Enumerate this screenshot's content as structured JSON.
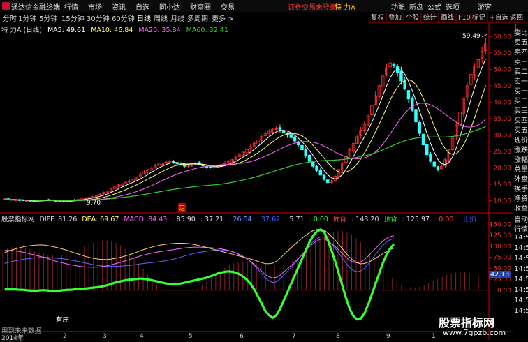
{
  "titlebar": {
    "app_name": "通达信金融终端",
    "menus": [
      "行情",
      "市场",
      "资讯",
      "自选",
      "同小达",
      "财富圈",
      "交易"
    ],
    "alert": "证券交易未登录",
    "stock_name": "特 力A",
    "right_menus": [
      "功能",
      "新盘",
      "公式",
      "选项"
    ],
    "guest": "游客",
    "win_buttons": [
      "—",
      "□",
      "✕"
    ]
  },
  "tabs": {
    "items": [
      "分时",
      "1分钟",
      "5分钟",
      "15分钟",
      "30分钟",
      "60分钟",
      "日线",
      "周线",
      "月线",
      "多周期",
      "更多 >"
    ],
    "active": "日线",
    "right_buttons": [
      "复权",
      "叠加",
      "个股",
      "统计",
      "画线",
      "F10",
      "标记",
      "+自选",
      "返回"
    ]
  },
  "main_header": {
    "name": "特 力A (日线)",
    "ma5": "MA5: 49.61",
    "ma10": "MA10: 46.84",
    "ma20": "MA20: 35.84",
    "ma60": "MA60: 32.41"
  },
  "indicator_header": {
    "name": "股票指标网",
    "diff": "DIFF: 81.26",
    "dea": "DEA: 69.67",
    "macd": "MACD: 84.43",
    "v1": ": 85.90",
    "v2": ": 37.21",
    "v3": ": 26.54",
    "v4": ": 37.62",
    "v5": ": 5.71",
    "v6": ": 0.00",
    "v7": "底背",
    "v8": ": 143.20",
    "v9": "顶背",
    "v10": ": 125.97",
    "v11": ": 0.00",
    "v12": ": 止损"
  },
  "annotations": {
    "low_price": "9.70",
    "high_price": "59.49",
    "ding_label": "定",
    "youzhuang": "有庄",
    "future_data": "用到未来数据",
    "macd_value": "42.13"
  },
  "right_panel": {
    "top_letters": "L",
    "items": [
      "委比",
      "卖五",
      "卖四",
      "卖三",
      "卖二",
      "卖一",
      "买一",
      "买二",
      "买三",
      "买四",
      "买五",
      "现价",
      "涨跌",
      "涨幅",
      "总量",
      "外盘",
      "换手",
      "净资",
      "收益"
    ],
    "bottom_items": [
      "自动",
      "行情",
      "14:5",
      "14:5",
      "14:5",
      "14:5",
      "14:5",
      "14:5",
      "14:5",
      "14:5"
    ]
  },
  "x_axis": {
    "year": "2014年",
    "months": [
      "2",
      "3",
      "4",
      "5",
      "6",
      "7",
      "8",
      "9",
      "1"
    ]
  },
  "watermark": {
    "title": "股票指标网",
    "url": "www.7gpzb.com"
  },
  "colors": {
    "up": "#ff3333",
    "down": "#33ffff",
    "ma5": "#ffffff",
    "ma10": "#ffff66",
    "ma20": "#ff66ff",
    "ma60": "#33cc33",
    "axis": "#cc0000",
    "green_line": "#33ff33"
  },
  "chart_data": [
    {
      "type": "candlestick",
      "title": "特 力A (日线)",
      "y_axis_ticks": [
        10.0,
        15.0,
        20.0,
        25.0,
        30.0,
        35.0,
        40.0,
        45.0,
        50.0,
        55.0,
        60.0
      ],
      "ylim": [
        8,
        62
      ],
      "annotations": {
        "low": 9.7,
        "high": 59.49
      },
      "series": [
        {
          "name": "MA5",
          "value": 49.61
        },
        {
          "name": "MA10",
          "value": 46.84
        },
        {
          "name": "MA20",
          "value": 35.84
        },
        {
          "name": "MA60",
          "value": 32.41
        }
      ],
      "close_path": [
        10.5,
        10.4,
        10.3,
        10.2,
        10.1,
        10.0,
        9.9,
        9.8,
        9.9,
        10.0,
        10.1,
        10.2,
        10.3,
        10.1,
        9.9,
        9.8,
        9.7,
        9.9,
        10.1,
        10.2,
        10.4,
        10.6,
        10.8,
        11.0,
        11.3,
        11.6,
        12.0,
        12.5,
        13.0,
        13.6,
        14.2,
        14.8,
        15.2,
        15.6,
        16.0,
        16.5,
        17.2,
        18.0,
        18.8,
        19.5,
        20.0,
        20.6,
        21.2,
        21.5,
        21.8,
        22.0,
        21.6,
        21.2,
        20.8,
        20.5,
        20.8,
        21.2,
        21.5,
        21.0,
        20.6,
        20.2,
        20.0,
        20.3,
        20.6,
        21.0,
        21.5,
        22.0,
        22.5,
        23.2,
        24.0,
        24.8,
        25.6,
        26.5,
        27.5,
        28.5,
        29.5,
        30.5,
        31.2,
        31.8,
        32.0,
        31.5,
        30.8,
        30.0,
        29.2,
        28.2,
        27.0,
        25.5,
        23.8,
        22.0,
        20.5,
        19.2,
        17.8,
        16.5,
        15.5,
        16.0,
        17.5,
        19.5,
        21.5,
        23.5,
        25.5,
        27.5,
        29.5,
        31.5,
        33.5,
        36.0,
        39.0,
        42.0,
        45.0,
        48.0,
        50.5,
        52.0,
        51.0,
        49.0,
        46.5,
        44.0,
        41.0,
        37.5,
        34.0,
        30.5,
        27.0,
        24.0,
        22.0,
        20.5,
        19.5,
        20.5,
        22.5,
        25.5,
        29.0,
        33.0,
        37.0,
        41.0,
        45.0,
        48.5,
        51.0,
        53.0,
        55.5,
        58.0
      ]
    },
    {
      "type": "macd",
      "y_axis_ticks": [
        0.0,
        25.0,
        50.0,
        75.0,
        100.0,
        125.0,
        150.0
      ],
      "ylim": [
        -75,
        160
      ],
      "series": [
        {
          "name": "DIFF",
          "value": 81.26
        },
        {
          "name": "DEA",
          "value": 69.67
        },
        {
          "name": "MACD",
          "value": 84.43
        }
      ],
      "green_line": [
        2,
        2,
        2,
        2,
        1,
        1,
        0,
        -1,
        -1,
        -1,
        0,
        0,
        -1,
        -2,
        -2,
        -1,
        0,
        1,
        1,
        2,
        3,
        3,
        4,
        5,
        6,
        7,
        8,
        10,
        12,
        15,
        18,
        20,
        22,
        24,
        25,
        26,
        27,
        28,
        27,
        26,
        24,
        22,
        20,
        18,
        16,
        15,
        14,
        15,
        16,
        18,
        20,
        22,
        24,
        26,
        28,
        30,
        33,
        36,
        40,
        42,
        44,
        45,
        44,
        42,
        38,
        32,
        25,
        15,
        2,
        -15,
        -32,
        -50,
        -60,
        -66,
        -60,
        -45,
        -25,
        -5,
        15,
        35,
        55,
        75,
        95,
        115,
        130,
        140,
        145,
        140,
        120,
        95,
        70,
        40,
        10,
        -20,
        -45,
        -62,
        -70,
        -68,
        -55,
        -35,
        -10,
        15,
        40,
        65,
        85,
        100,
        110
      ]
    }
  ]
}
